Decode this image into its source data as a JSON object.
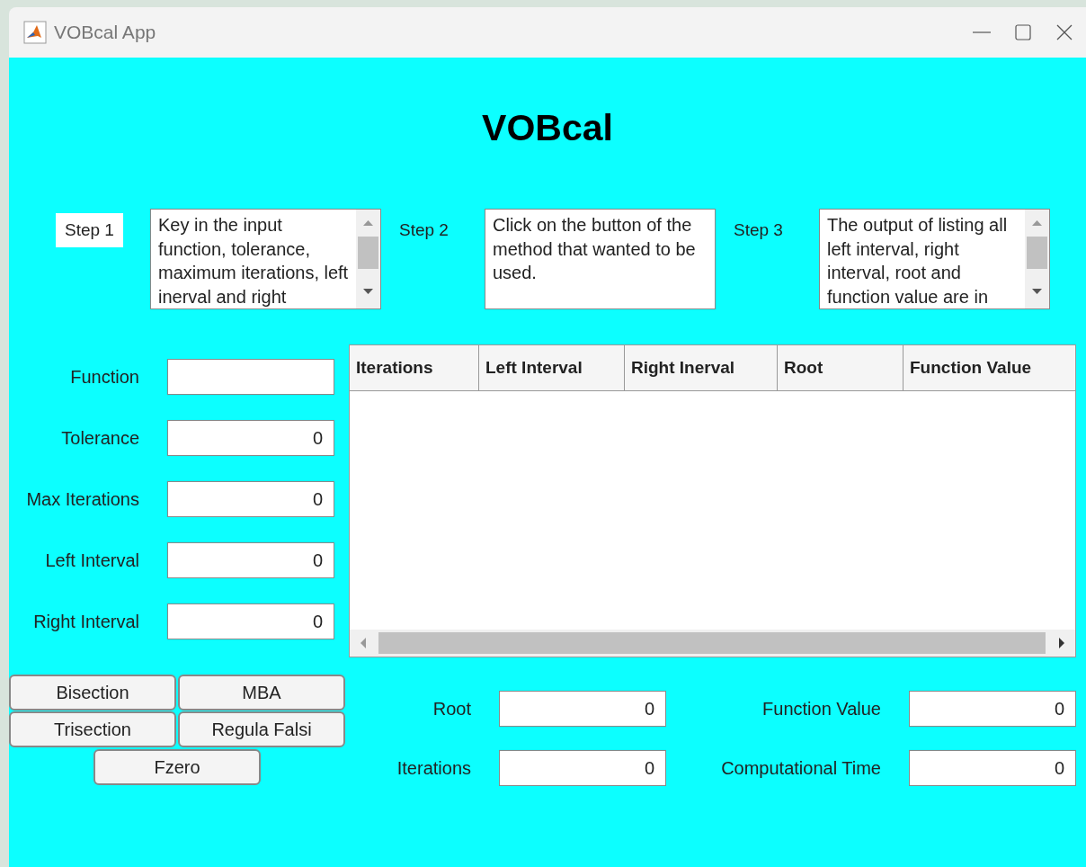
{
  "window": {
    "title": "VOBcal App"
  },
  "heading": "VOBcal",
  "steps": [
    {
      "label": "Step 1",
      "highlighted": true,
      "text": "Key in the input function, tolerance, maximum iterations, left inerval and right",
      "scrollable": true
    },
    {
      "label": "Step 2",
      "highlighted": false,
      "text": "Click on the button of the method that wanted to be used.",
      "scrollable": false
    },
    {
      "label": "Step 3",
      "highlighted": false,
      "text": "The output of listing all left interval, right interval, root and function value are in",
      "scrollable": true
    }
  ],
  "inputs": [
    {
      "label": "Function"
    },
    {
      "label": "Tolerance",
      "value": "0"
    },
    {
      "label": "Max Iterations",
      "value": "0"
    },
    {
      "label": "Left Interval",
      "value": "0"
    },
    {
      "label": "Right Interval",
      "value": "0"
    }
  ],
  "table": {
    "columns": [
      "Iterations",
      "Left Interval",
      "Right Inerval",
      "Root",
      "Function Value"
    ]
  },
  "methods": [
    "Bisection",
    "MBA",
    "Trisection",
    "Regula Falsi",
    "Fzero"
  ],
  "results": [
    {
      "label": "Root",
      "value": "0"
    },
    {
      "label": "Function Value",
      "value": "0"
    },
    {
      "label": "Iterations",
      "value": "0"
    },
    {
      "label": "Computational Time",
      "value": "0"
    }
  ]
}
